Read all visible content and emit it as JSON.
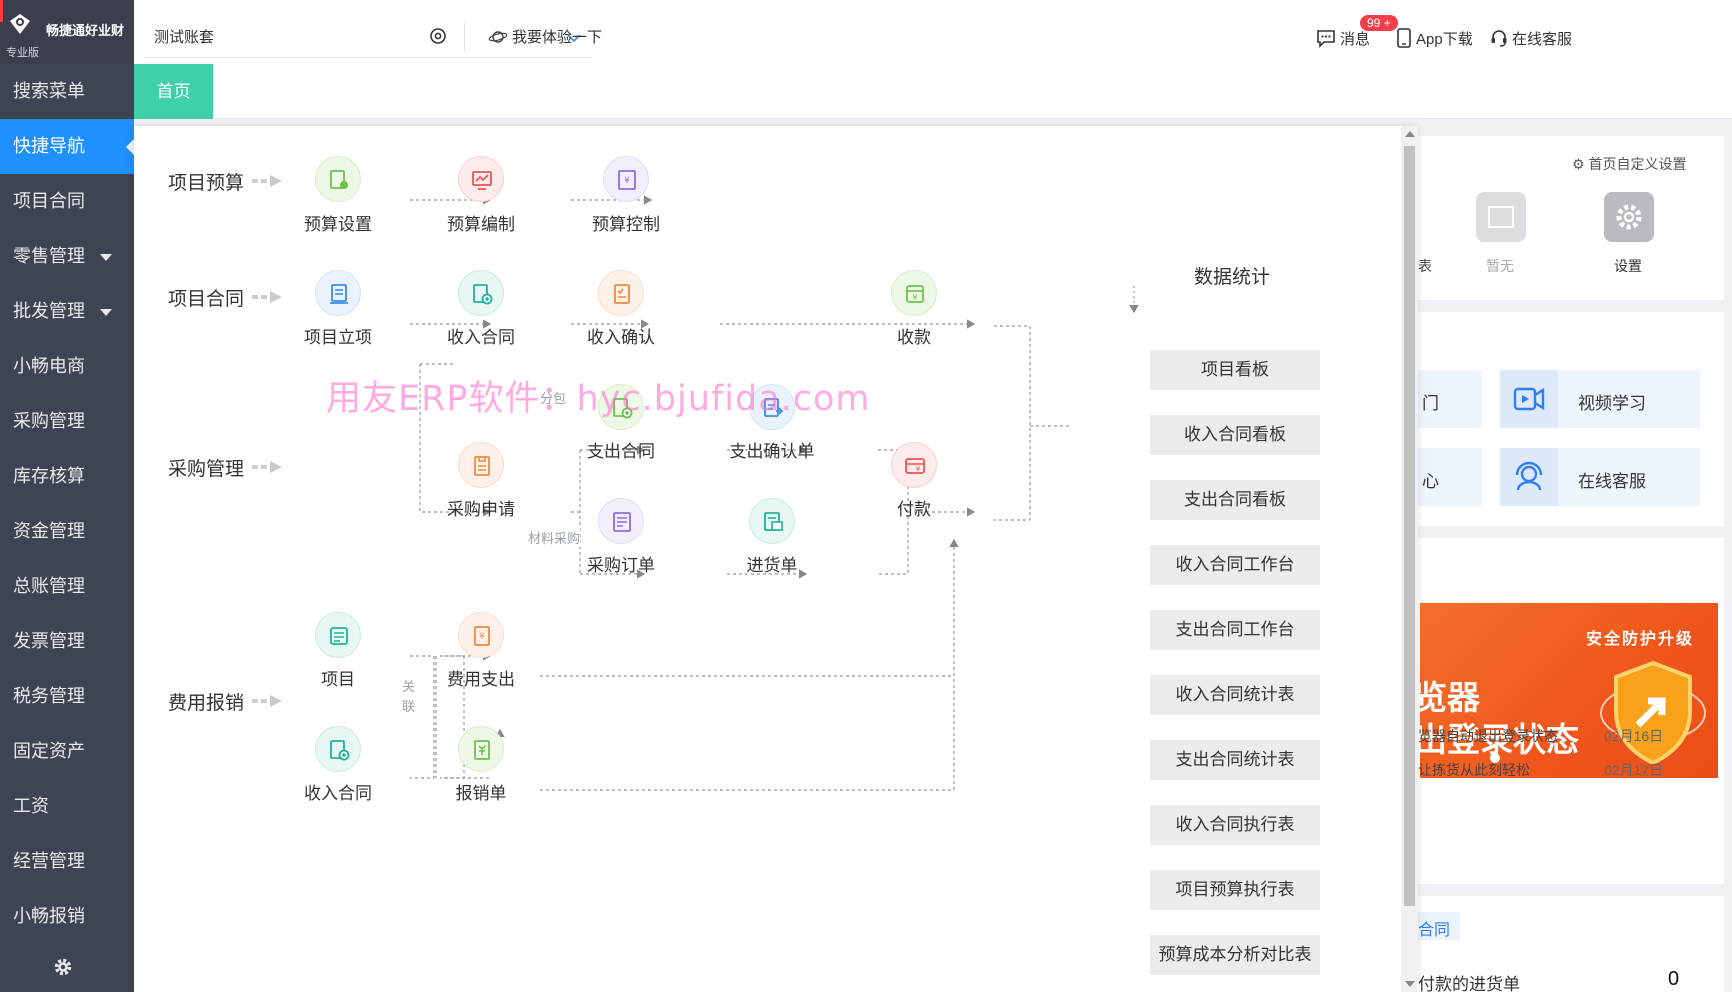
{
  "app": {
    "name": "畅捷通好业财",
    "edition": "专业版"
  },
  "sidebar": {
    "items": [
      {
        "label": "搜索菜单"
      },
      {
        "label": "快捷导航",
        "active": true
      },
      {
        "label": "项目合同"
      },
      {
        "label": "零售管理",
        "has_caret": true
      },
      {
        "label": "批发管理",
        "has_caret": true
      },
      {
        "label": "小畅电商"
      },
      {
        "label": "采购管理"
      },
      {
        "label": "库存核算"
      },
      {
        "label": "资金管理"
      },
      {
        "label": "总账管理"
      },
      {
        "label": "发票管理"
      },
      {
        "label": "税务管理"
      },
      {
        "label": "固定资产"
      },
      {
        "label": "工资"
      },
      {
        "label": "经营管理"
      },
      {
        "label": "小畅报销"
      }
    ],
    "settings_icon": "gear-icon"
  },
  "header": {
    "account": "测试账套",
    "try_label": "我要体验一下",
    "messages_label": "消息",
    "messages_badge": "99 +",
    "app_download_label": "App下载",
    "service_label": "在线客服"
  },
  "tabs": {
    "home": "首页"
  },
  "colors": {
    "sidebar_bg": "#3f4452",
    "accent_blue": "#1e90ff",
    "tab_green": "#3fcfa9",
    "badge_red": "#f43f4a"
  },
  "dashboard": {
    "custom_setting": "首页自定义设置",
    "quick_partial": "表",
    "quick_none": "暂无",
    "quick_settings": "设置",
    "help_partial_1": "门",
    "help_partial_2": "心",
    "video_learning": "视频学习",
    "online_service": "在线客服",
    "banner_title": "安全防护升级",
    "banner_line1": "览器",
    "banner_line2": "出登录状态",
    "news": [
      {
        "text": "览器自动退出登录状态",
        "date": "02月16日"
      },
      {
        "text": "让拣货从此刻轻松",
        "date": "02月17日"
      }
    ],
    "tab_partial": "合同",
    "pending_label": "付款的进货单",
    "pending_value": "0"
  },
  "flow": {
    "rows": {
      "budget": "项目预算",
      "contract": "项目合同",
      "purchase": "采购管理",
      "expense": "费用报销"
    },
    "nodes": {
      "budget_setting": "预算设置",
      "budget_compile": "预算编制",
      "budget_control": "预算控制",
      "project_setup": "项目立项",
      "income_contract": "收入合同",
      "income_confirm": "收入确认",
      "receipt": "收款",
      "expense_contract": "支出合同",
      "expense_confirm": "支出确认单",
      "purchase_request": "采购申请",
      "purchase_order": "采购订单",
      "goods_receipt": "进货单",
      "payment": "付款",
      "project": "项目",
      "expense_payout": "费用支出",
      "income_contract_2": "收入合同",
      "reimbursement": "报销单"
    },
    "mini": {
      "subcontract": "分包",
      "material_purchase": "材料采购",
      "related": "关",
      "related2": "联"
    },
    "stats_title": "数据统计",
    "stats": [
      "项目看板",
      "收入合同看板",
      "支出合同看板",
      "收入合同工作台",
      "支出合同工作台",
      "收入合同统计表",
      "支出合同统计表",
      "收入合同执行表",
      "项目预算执行表",
      "预算成本分析对比表"
    ]
  },
  "watermark": "用友ERP软件：hyc.bjufida.com"
}
